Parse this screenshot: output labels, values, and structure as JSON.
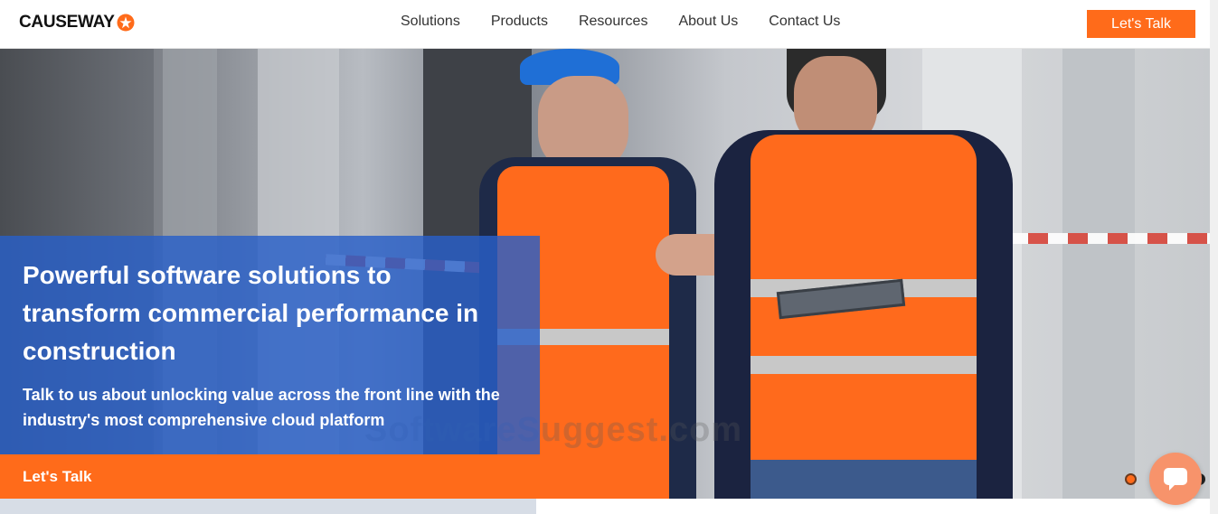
{
  "header": {
    "logo_text": "CAUSEWAY",
    "nav": [
      "Solutions",
      "Products",
      "Resources",
      "About Us",
      "Contact Us"
    ],
    "cta_label": "Let's Talk"
  },
  "hero": {
    "title": "Powerful software solutions to transform commercial performance in construction",
    "subtitle": "Talk to us about unlocking value across the front line with the industry's most comprehensive cloud platform",
    "cta_label": "Let's Talk",
    "watermark": "SoftwareSuggest.com"
  },
  "colors": {
    "accent": "#ff6b1a",
    "panel_blue": "#285fc8"
  },
  "icons": {
    "logo_mark": "orange-star-icon",
    "chat": "chat-bubble-icon"
  }
}
